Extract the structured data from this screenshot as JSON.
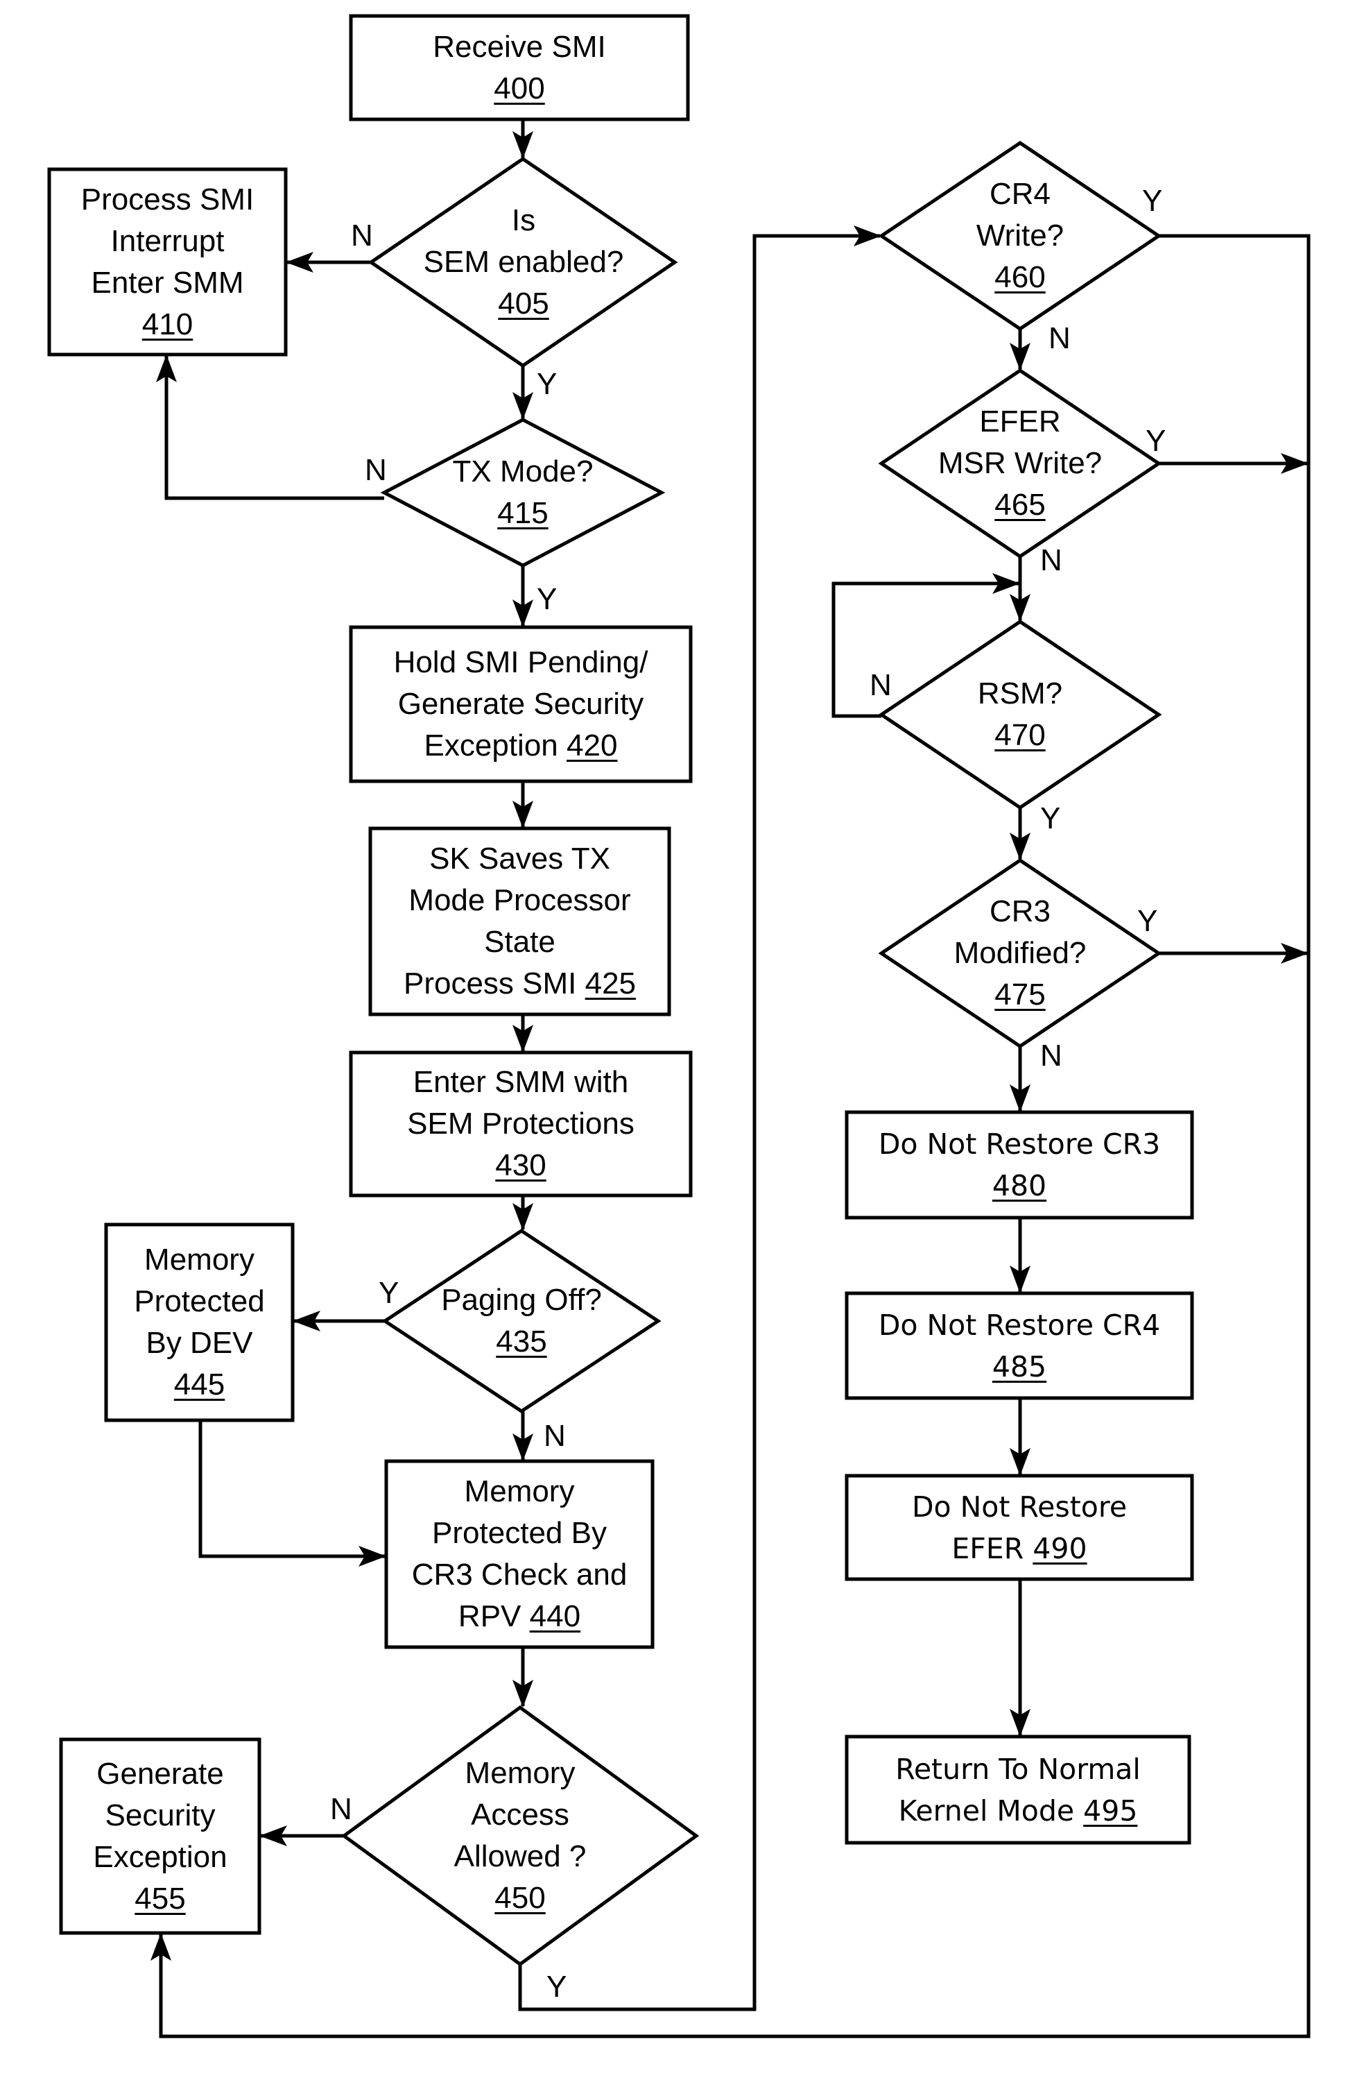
{
  "nodes": {
    "n400": {
      "lines": [
        "Receive SMI"
      ],
      "ref": "400",
      "inline_ref": false
    },
    "n405": {
      "lines": [
        "Is",
        "SEM enabled?"
      ],
      "ref": "405",
      "inline_ref": false
    },
    "n410": {
      "lines": [
        "Process SMI",
        "Interrupt",
        "Enter SMM"
      ],
      "ref": "410",
      "inline_ref": false
    },
    "n415": {
      "lines": [
        "TX Mode?"
      ],
      "ref": "415",
      "inline_ref": false
    },
    "n420": {
      "lines": [
        "Hold SMI Pending/",
        "Generate Security",
        "Exception"
      ],
      "ref": "420",
      "inline_ref": true
    },
    "n425": {
      "lines": [
        "SK Saves TX",
        "Mode Processor",
        "State",
        "Process SMI"
      ],
      "ref": "425",
      "inline_ref": true
    },
    "n430": {
      "lines": [
        "Enter SMM with",
        "SEM Protections"
      ],
      "ref": "430",
      "inline_ref": false
    },
    "n435": {
      "lines": [
        "Paging Off?"
      ],
      "ref": "435",
      "inline_ref": false
    },
    "n440": {
      "lines": [
        "Memory",
        "Protected By",
        "CR3 Check and",
        "RPV"
      ],
      "ref": "440",
      "inline_ref": true
    },
    "n445": {
      "lines": [
        "Memory",
        "Protected",
        "By DEV"
      ],
      "ref": "445",
      "inline_ref": false
    },
    "n450": {
      "lines": [
        "Memory",
        "Access",
        "Allowed ?"
      ],
      "ref": "450",
      "inline_ref": false
    },
    "n455": {
      "lines": [
        "Generate",
        "Security",
        "Exception"
      ],
      "ref": "455",
      "inline_ref": false
    },
    "n460": {
      "lines": [
        "CR4",
        "Write?"
      ],
      "ref": "460",
      "inline_ref": false
    },
    "n465": {
      "lines": [
        "EFER",
        "MSR Write?"
      ],
      "ref": "465",
      "inline_ref": false
    },
    "n470": {
      "lines": [
        "RSM?"
      ],
      "ref": "470",
      "inline_ref": false
    },
    "n475": {
      "lines": [
        "CR3",
        "Modified?"
      ],
      "ref": "475",
      "inline_ref": false
    },
    "n480": {
      "lines": [
        "Do Not Restore CR3"
      ],
      "ref": "480",
      "inline_ref": false
    },
    "n485": {
      "lines": [
        "Do Not Restore CR4"
      ],
      "ref": "485",
      "inline_ref": false
    },
    "n490": {
      "lines": [
        "Do Not Restore",
        "EFER"
      ],
      "ref": "490",
      "inline_ref": true
    },
    "n495": {
      "lines": [
        "Return To Normal",
        "Kernel Mode"
      ],
      "ref": "495",
      "inline_ref": true
    }
  },
  "edge_labels": {
    "e405_n": "N",
    "e405_y": "Y",
    "e415_n": "N",
    "e415_y": "Y",
    "e435_y": "Y",
    "e435_n": "N",
    "e450_n": "N",
    "e450_y": "Y",
    "e460_y": "Y",
    "e460_n": "N",
    "e465_y": "Y",
    "e465_n": "N",
    "e470_n": "N",
    "e470_y": "Y",
    "e475_y": "Y",
    "e475_n": "N"
  },
  "colors": {
    "stroke": "#000000",
    "background": "#ffffff"
  }
}
